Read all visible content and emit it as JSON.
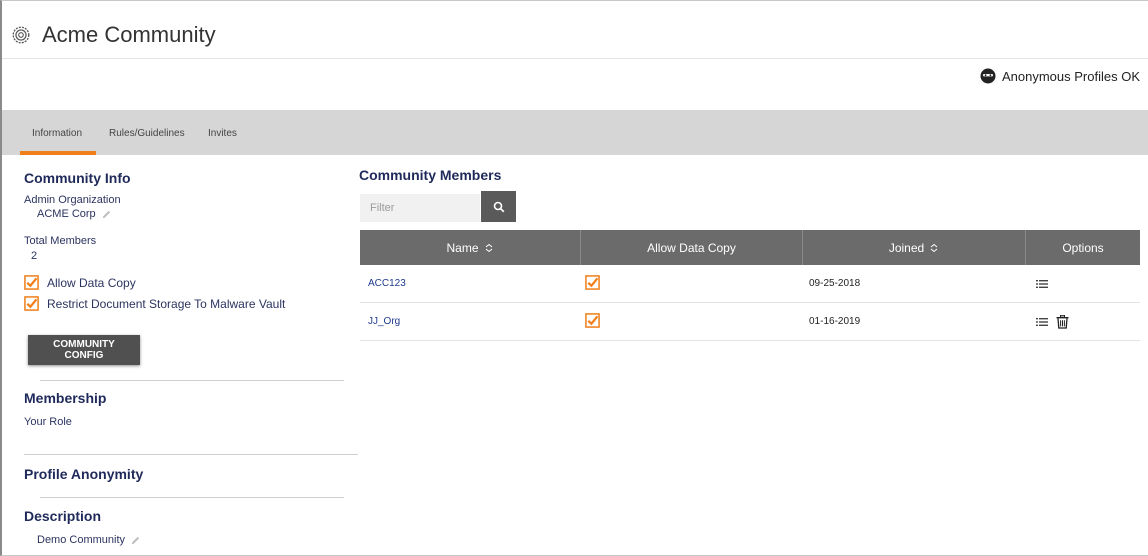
{
  "app": {
    "title": "Acme Community",
    "settings_icon": "gear-icon"
  },
  "header": {
    "anonymous_label": "Anonymous Profiles OK",
    "anonymous_icon": "anonymous-mask-icon"
  },
  "tabs": [
    {
      "label": "Information",
      "active": true
    },
    {
      "label": "Rules/Guidelines",
      "active": false
    },
    {
      "label": "Invites",
      "active": false
    }
  ],
  "info": {
    "heading": "Community Info",
    "admin_org_label": "Admin Organization",
    "admin_org_value": "ACME Corp",
    "total_members_label": "Total Members",
    "total_members_value": "2",
    "allow_data_copy": {
      "label": "Allow Data Copy",
      "checked": true
    },
    "restrict_storage": {
      "label": "Restrict Document Storage To Malware Vault",
      "checked": true
    },
    "config_button": "COMMUNITY CONFIG"
  },
  "membership": {
    "heading": "Membership",
    "role_label": "Your Role"
  },
  "anonymity": {
    "heading": "Profile Anonymity"
  },
  "description": {
    "heading": "Description",
    "value": "Demo Community"
  },
  "members": {
    "heading": "Community Members",
    "filter_placeholder": "Filter",
    "columns": [
      "Name",
      "Allow Data Copy",
      "Joined",
      "Options"
    ],
    "rows": [
      {
        "name": "ACC123",
        "allow_copy": true,
        "joined": "09-25-2018",
        "can_delete": false
      },
      {
        "name": "JJ_Org",
        "allow_copy": true,
        "joined": "01-16-2019",
        "can_delete": true
      }
    ]
  },
  "colors": {
    "accent": "#f07f1a",
    "heading": "#1f2a5a",
    "header_bg": "#6b6b6b",
    "tab_bg": "#d6d6d6"
  }
}
